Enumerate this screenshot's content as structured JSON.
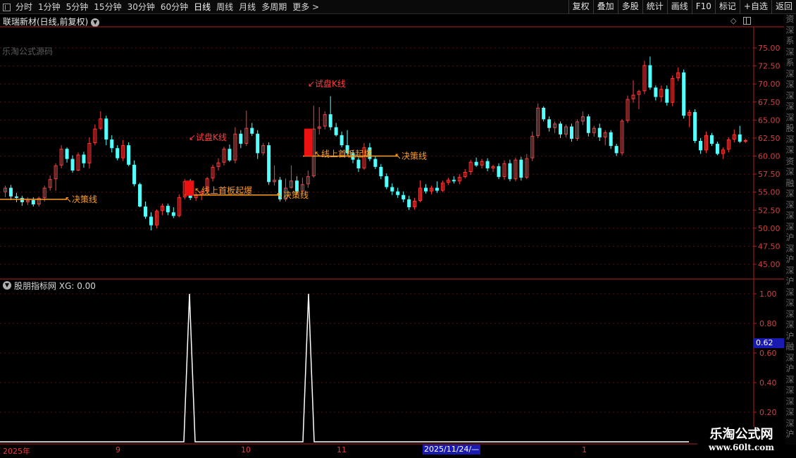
{
  "toolbar": {
    "periods": [
      "分时",
      "1分钟",
      "5分钟",
      "15分钟",
      "30分钟",
      "60分钟",
      "日线",
      "周线",
      "月线",
      "多周期",
      "更多"
    ],
    "active_period": "日线",
    "buttons": [
      "复权",
      "叠加",
      "多股",
      "统计",
      "画线",
      "F10",
      "标记",
      "+自选",
      "返回"
    ]
  },
  "chart": {
    "title": "联瑞新材(日线,前复权)",
    "watermark": "乐淘公式源码",
    "price_ticks": [
      "75.00",
      "72.50",
      "70.00",
      "67.50",
      "65.00",
      "62.50",
      "60.00",
      "57.50",
      "55.00",
      "52.50",
      "50.00",
      "47.50",
      "45.00"
    ],
    "price_range": [
      45,
      75
    ],
    "annotations": {
      "trial_k": "试盘K线",
      "breakout": "线上首板起爆",
      "decision": "决策线"
    },
    "colors": {
      "up": "#ff3c3c",
      "down": "#54ffff",
      "decision_line": "#ffa020",
      "breakout": "#ff9b20",
      "trial": "#ff4040",
      "signal_bar": "#ee1111"
    }
  },
  "indicator": {
    "title": "股朋指标网",
    "readout": "XG: 0.00",
    "ticks": [
      "1.00",
      "0.80",
      "0.60",
      "0.40",
      "0.20"
    ],
    "cursor_value": "0.62",
    "signal_value": 1,
    "color": "#ffffff"
  },
  "side_strip": {
    "chars": [
      "资",
      "深",
      "系",
      "深",
      "系",
      "深",
      "深",
      "深",
      "深",
      "深",
      "股",
      "深",
      "深",
      "资",
      "深",
      "融",
      "深",
      "深",
      "深",
      "深",
      "沪",
      "深",
      "沪",
      "深",
      "沪",
      "深",
      "深",
      "深",
      "深",
      "沪",
      "融",
      "深",
      "沪",
      "深",
      "深",
      "深",
      "深",
      "深",
      "沪"
    ]
  },
  "datebar": {
    "labels": [
      "2025年",
      "9",
      "10",
      "11",
      "1"
    ],
    "cursor_date": "2025/11/24/—"
  },
  "brand": {
    "name": "乐淘公式网",
    "url": "www.60lt.com"
  }
}
